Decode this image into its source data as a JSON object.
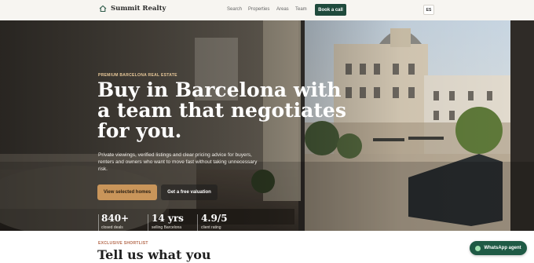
{
  "header": {
    "brand": "Summit Realty",
    "nav": [
      "Search",
      "Properties",
      "Areas",
      "Team"
    ],
    "cta": "Book a call",
    "language": "ES"
  },
  "hero": {
    "eyebrow": "PREMIUM BARCELONA REAL ESTATE",
    "headline_lines": [
      "Buy in Barcelona with",
      "a team that negotiates",
      "for you."
    ],
    "lead": "Private viewings, verified listings and clear pricing advice for buyers, renters and owners who want to move fast without taking unnecessary risk.",
    "primary_cta": "View selected homes",
    "secondary_cta": "Get a free valuation",
    "stats": [
      {
        "value": "840+",
        "label": "closed deals"
      },
      {
        "value": "14 yrs",
        "label": "selling Barcelona"
      },
      {
        "value": "4.9/5",
        "label": "client rating"
      }
    ]
  },
  "shortlist": {
    "eyebrow": "EXCLUSIVE SHORTLIST",
    "title": "Tell us what you"
  },
  "floating": {
    "whatsapp": "WhatsApp agent"
  },
  "colors": {
    "brand_green": "#1f4a3c",
    "accent_gold": "#c9955a",
    "eyebrow_rust": "#b4694c"
  }
}
